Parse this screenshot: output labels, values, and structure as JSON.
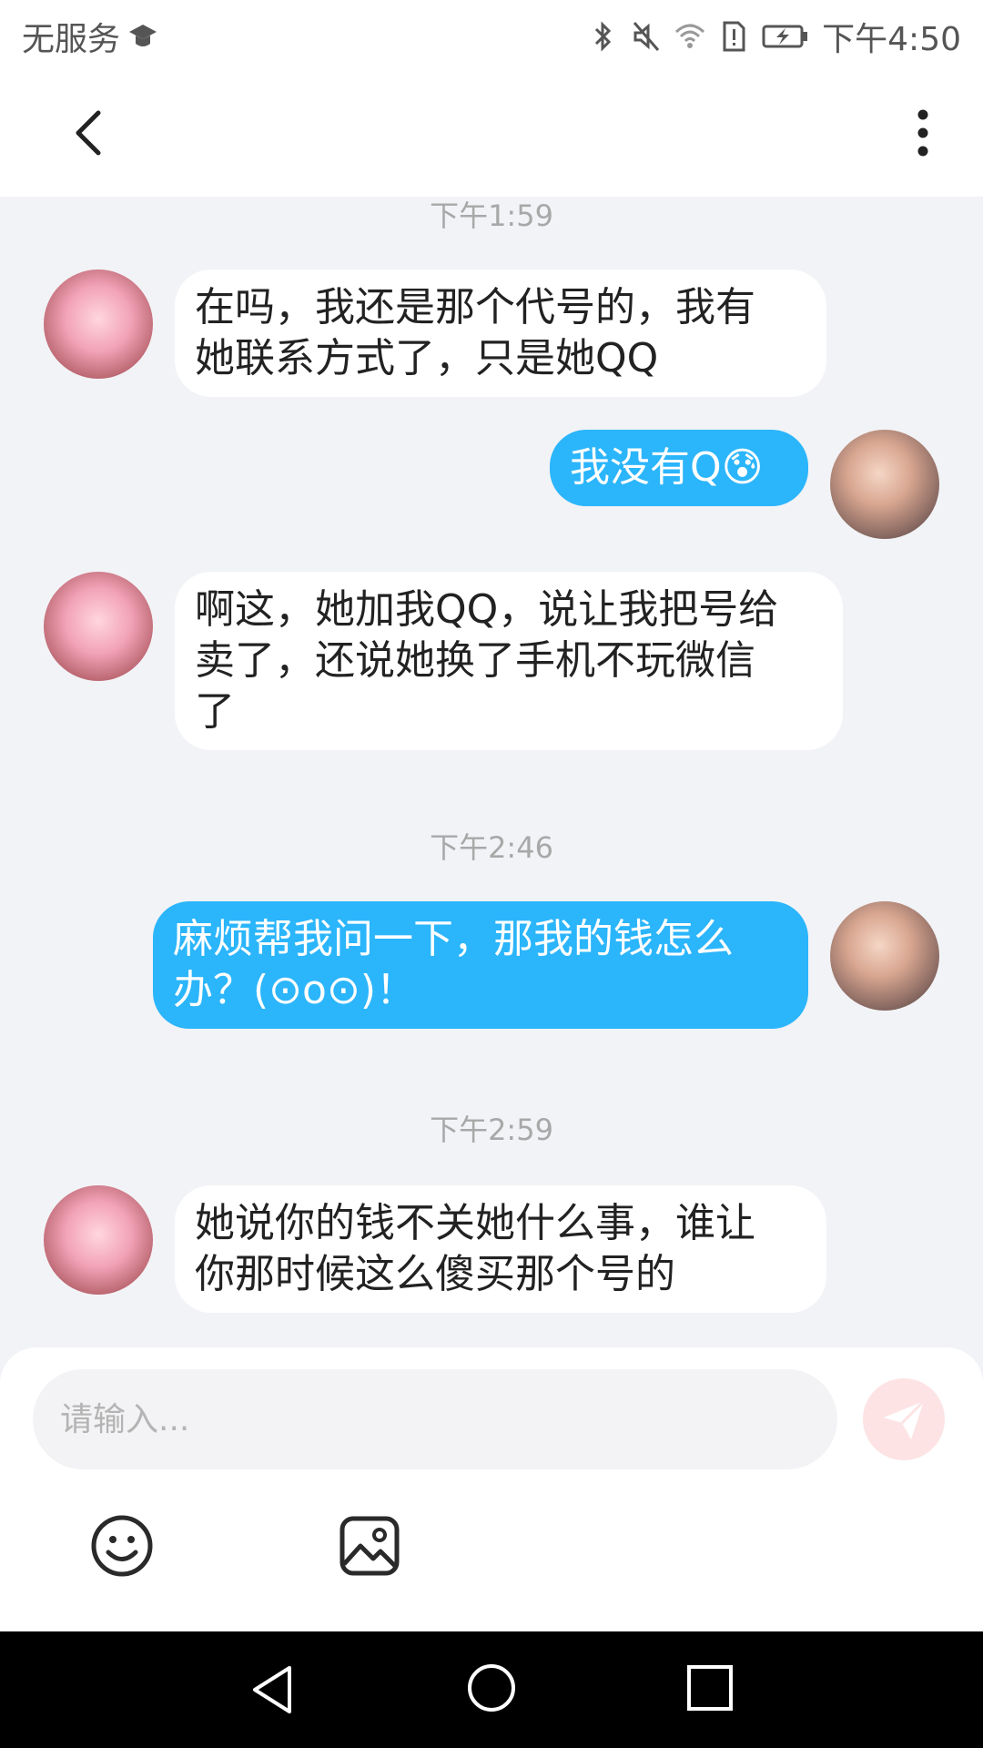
{
  "status_bar": {
    "carrier": "无服务",
    "time": "下午4:50",
    "icons": [
      "graduation-cap-icon",
      "bluetooth-icon",
      "mute-icon",
      "wifi-icon",
      "sim-alert-icon",
      "battery-charging-icon"
    ]
  },
  "header": {
    "back_icon": "chevron-left-icon",
    "more_icon": "more-vertical-icon"
  },
  "messages": [
    {
      "type": "timestamp",
      "text": "下午1:59"
    },
    {
      "type": "incoming",
      "sender": "friend",
      "text": "在吗，我还是那个代号的，我有\n她联系方式了，只是她QQ"
    },
    {
      "type": "outgoing",
      "sender": "me",
      "text": "我没有Q😰"
    },
    {
      "type": "incoming",
      "sender": "friend",
      "text": "啊这，她加我QQ，说让我把号给\n卖了，还说她换了手机不玩微信\n了"
    },
    {
      "type": "timestamp",
      "text": "下午2:46"
    },
    {
      "type": "outgoing",
      "sender": "me",
      "text": "麻烦帮我问一下，那我的钱怎么\n办？(⊙o⊙)！"
    },
    {
      "type": "timestamp",
      "text": "下午2:59"
    },
    {
      "type": "incoming",
      "sender": "friend",
      "text": "她说你的钱不关她什么事，谁让\n你那时候这么傻买那个号的"
    }
  ],
  "input": {
    "placeholder": "请输入...",
    "value": ""
  },
  "toolbar": {
    "send_icon": "send-icon",
    "emoji_icon": "emoji-icon",
    "image_icon": "image-icon"
  },
  "nav_bar": {
    "icons": [
      "nav-back-icon",
      "nav-home-icon",
      "nav-recent-icon"
    ]
  },
  "colors": {
    "outgoing_bubble": "#2bb5fb",
    "incoming_bubble": "#ffffff",
    "chat_background": "#f2f3f6",
    "send_button": "#fde3e4",
    "timestamp_text": "#a8a8a8"
  }
}
